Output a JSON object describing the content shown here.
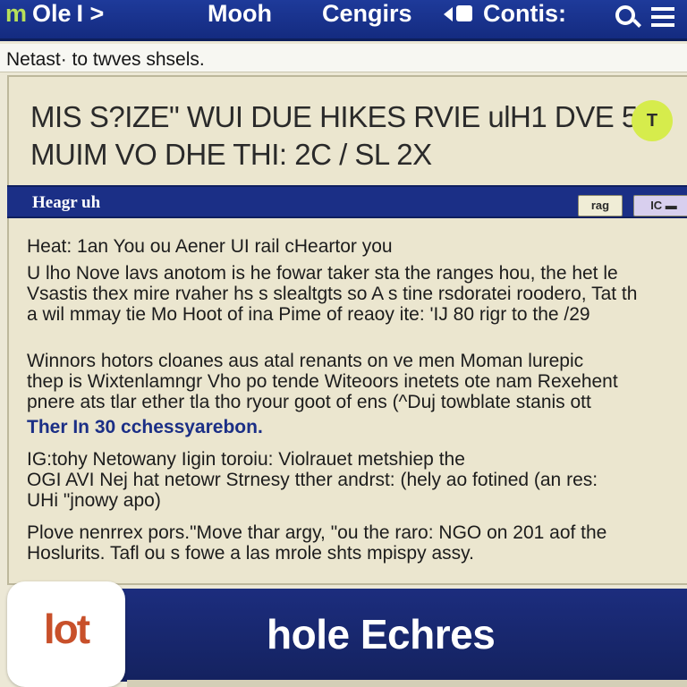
{
  "nav": {
    "logo_label": "Ole",
    "logo_letter": "m",
    "logo_suffix": "I >",
    "item_1": "Mooh",
    "item_2": "Cengirs",
    "item_3": "Contis:",
    "search_icon": "search-icon",
    "menu_icon": "hamburger-menu-icon"
  },
  "subtitle": "Netast· to twves shsels.",
  "article": {
    "headline_line1": "MIS S?IZE\" WUI DUE HIKES RVIE ulH1 DVE 5",
    "headline_line2": "MUIM VO DHE THI: 2C / SL 2X",
    "badge": "T",
    "section_title": "Heagr uh",
    "section_btn_1": "rag",
    "section_btn_2": "IC ▬",
    "para_1": "Heat: 1an You ou Aener UI rail cHeartor you",
    "para_2_l1": "U lho Nove lavs anotom is he fowar taker sta the ranges hou, the het le",
    "para_2_l2": "Vsastis thex mire rvaher hs s slealtgts so A s tine rsdoratei roodero, Tat th",
    "para_2_l3": "a wil mmay tie Mo Hoot of ina Pime of reaoy ite: 'IJ 80 rigr to the /29",
    "para_3_l1": "Winnors hotors cloanes aus atal renants on ve men Moman lurepic",
    "para_3_l2": "thep is Wixtenlamngr Vho po tende Witeoors inetets ote nam Rexehent",
    "para_3_l3": "pnere ats tlar ether tla tho ryour goot of ens (^Duj towblate stanis ott",
    "para_4": "Ther In 30 cchessyarebon.",
    "para_5_l1": "IG:tohy Netowany Iigin toroiu: Violrauet metshiep the",
    "para_5_l2": "OGI AVI Nej hat netowr Strnesy tther andrst: (hely ao fotined (an res:",
    "para_5_l3": "UHi \"jnowy apo)",
    "para_6_l1": "Plove nenrrex pors.\"Move thar argy, \"ou the raro: NGO on 201 aof the",
    "para_6_l2": "Hoslurits. Tafl ou s fowe a las mrole shts mpispy assy."
  },
  "footer": {
    "app_tile_label": "lot",
    "title": "hole Echres"
  },
  "colors": {
    "nav_blue": "#1e3a9a",
    "section_blue": "#1b2f86",
    "badge_yellow": "#d6ec4c",
    "page_bg": "#ece8d6",
    "tile_orange": "#c8502a"
  }
}
